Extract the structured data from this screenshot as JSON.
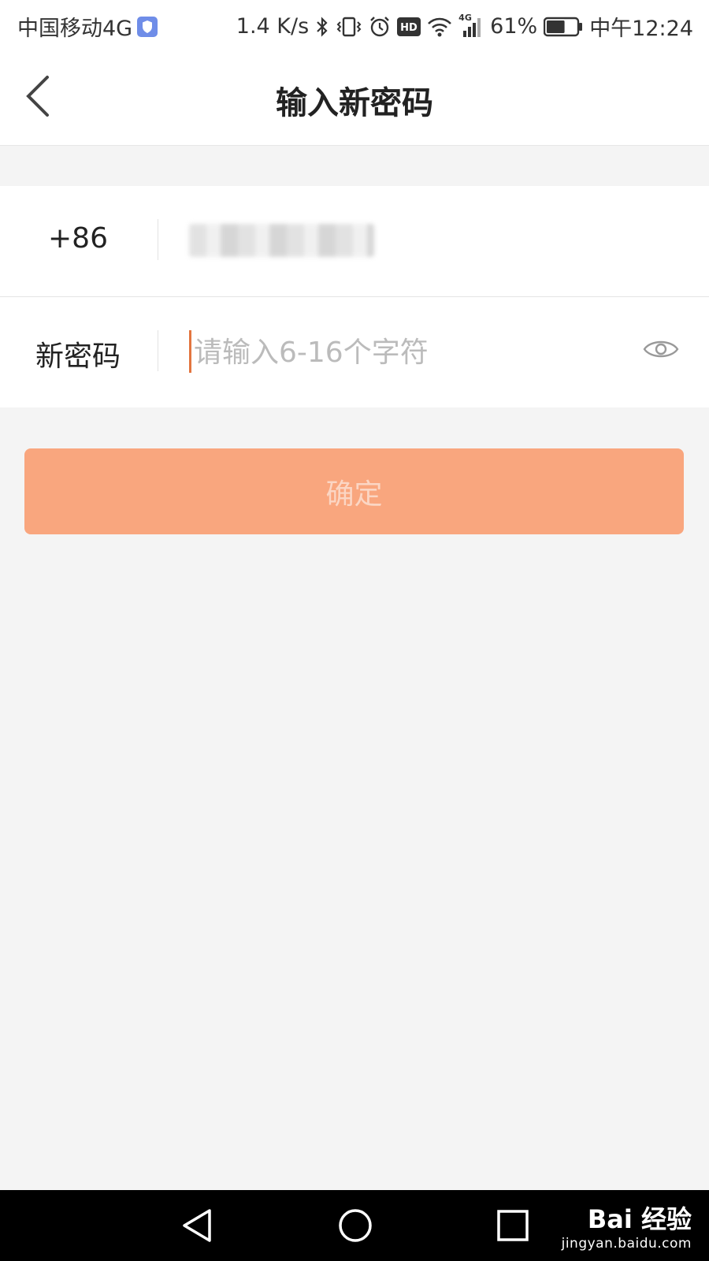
{
  "status_bar": {
    "carrier": "中国移动4G",
    "speed": "1.4 K/s",
    "network": "4G",
    "battery": "61%",
    "time": "中午12:24",
    "icons": [
      "shield-icon",
      "bluetooth-icon",
      "vibrate-icon",
      "alarm-icon",
      "hd-icon",
      "wifi-icon",
      "signal-icon",
      "battery-icon"
    ]
  },
  "header": {
    "title": "输入新密码",
    "back_icon": "chevron-left-icon"
  },
  "form": {
    "country_code": "+86",
    "password_label": "新密码",
    "password_placeholder": "请输入6-16个字符",
    "password_value": "",
    "visibility_icon": "eye-icon"
  },
  "confirm_label": "确定",
  "colors": {
    "accent": "#f9a67e",
    "accent_text": "#fbd6c4",
    "cursor": "#e3753f",
    "background": "#f4f4f4"
  },
  "watermark": {
    "brand": "Bai 经验",
    "site": "jingyan.baidu.com"
  }
}
